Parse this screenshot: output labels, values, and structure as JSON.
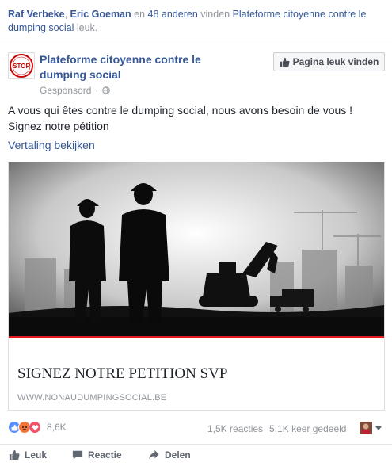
{
  "social_context": {
    "friend_1": "Raf Verbeke",
    "separator": ", ",
    "friend_2": "Eric Goeman",
    "middle": " en ",
    "others_link": "48 anderen",
    "verb": " vinden ",
    "page_link": "Plateforme citoyenne contre le dumping social",
    "suffix": " leuk."
  },
  "post": {
    "page_name": "Plateforme citoyenne contre le dumping social",
    "sponsored": "Gesponsord",
    "sponsored_sep": "·",
    "like_page_button": "Pagina leuk vinden",
    "avatar_text": "STOP",
    "text": "A vous qui êtes contre le dumping social, nous avons besoin de vous ! Signez notre pétition",
    "see_translation": "Vertaling bekijken"
  },
  "link_card": {
    "title": "SIGNEZ NOTRE PETITION SVP",
    "domain": "WWW.NONAUDUMPINGSOCIAL.BE"
  },
  "engagement": {
    "reaction_count": "8,6K",
    "reactions_label": "1,5K reacties",
    "shares_label": "5,1K keer gedeeld"
  },
  "actions": {
    "like": "Leuk",
    "comment": "Reactie",
    "share": "Delen"
  },
  "colors": {
    "link": "#365899",
    "muted": "#90949c",
    "card_stripe": "#e11a22"
  },
  "icons": [
    "globe-icon",
    "thumbs-up-icon",
    "like-reaction-icon",
    "angry-reaction-icon",
    "love-reaction-icon",
    "comment-icon",
    "share-icon",
    "chevron-down-icon"
  ]
}
